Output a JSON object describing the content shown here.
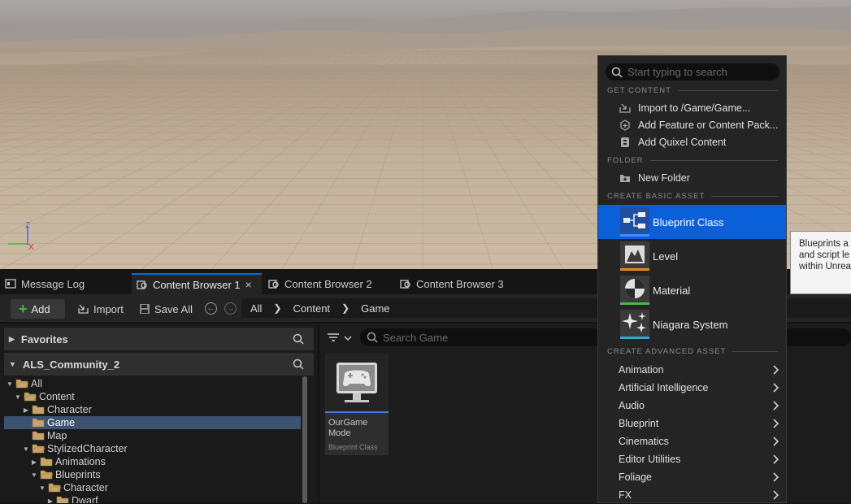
{
  "tabs": [
    {
      "label": "Message Log"
    },
    {
      "label": "Content Browser 1",
      "close": "×"
    },
    {
      "label": "Content Browser 2"
    },
    {
      "label": "Content Browser 3"
    }
  ],
  "toolbar": {
    "add_label": "Add",
    "import_label": "Import",
    "save_all_label": "Save All",
    "breadcrumb": [
      "All",
      "Content",
      "Game"
    ]
  },
  "sources": {
    "favorites_label": "Favorites",
    "project_label": "ALS_Community_2",
    "tree": [
      {
        "label": "All",
        "depth": 0,
        "expanded": true,
        "selected": false
      },
      {
        "label": "Content",
        "depth": 1,
        "expanded": true,
        "selected": false
      },
      {
        "label": "Character",
        "depth": 2,
        "expanded": false,
        "has_children": true,
        "selected": false
      },
      {
        "label": "Game",
        "depth": 2,
        "selected": true
      },
      {
        "label": "Map",
        "depth": 2,
        "selected": false
      },
      {
        "label": "StylizedCharacter",
        "depth": 2,
        "expanded": true,
        "selected": false
      },
      {
        "label": "Animations",
        "depth": 3,
        "expanded": false,
        "has_children": true,
        "selected": false
      },
      {
        "label": "Blueprints",
        "depth": 3,
        "expanded": true,
        "selected": false
      },
      {
        "label": "Character",
        "depth": 4,
        "expanded": true,
        "selected": false
      },
      {
        "label": "Dwarf",
        "depth": 5,
        "expanded": false,
        "has_children": true,
        "selected": false
      }
    ]
  },
  "content": {
    "search_placeholder": "Search Game",
    "assets": [
      {
        "name_line1": "OurGame",
        "name_line2": "Mode",
        "type": "Blueprint Class"
      }
    ]
  },
  "menu": {
    "search_placeholder": "Start typing to search",
    "get_content_header": "GET CONTENT",
    "get_content": [
      {
        "label": "Import to /Game/Game...",
        "icon": "import-icon"
      },
      {
        "label": "Add Feature or Content Pack...",
        "icon": "add-pack-icon"
      },
      {
        "label": "Add Quixel Content",
        "icon": "quixel-icon"
      }
    ],
    "folder_header": "FOLDER",
    "new_folder": "New Folder",
    "basic_header": "CREATE BASIC ASSET",
    "basic": [
      {
        "label": "Blueprint Class",
        "color": "#3f8ff0",
        "selected": true
      },
      {
        "label": "Level",
        "color": "#e08a20",
        "selected": false
      },
      {
        "label": "Material",
        "color": "#48b848",
        "selected": false
      },
      {
        "label": "Niagara System",
        "color": "#2aa8d8",
        "selected": false
      }
    ],
    "advanced_header": "CREATE ADVANCED ASSET",
    "advanced": [
      "Animation",
      "Artificial Intelligence",
      "Audio",
      "Blueprint",
      "Cinematics",
      "Editor Utilities",
      "Foliage",
      "FX"
    ]
  },
  "tooltip": {
    "line1": "Blueprints a",
    "line2": "and script le",
    "line3": "within Unrea"
  },
  "viewport": {
    "axis_z": "Z",
    "axis_x": "X"
  }
}
